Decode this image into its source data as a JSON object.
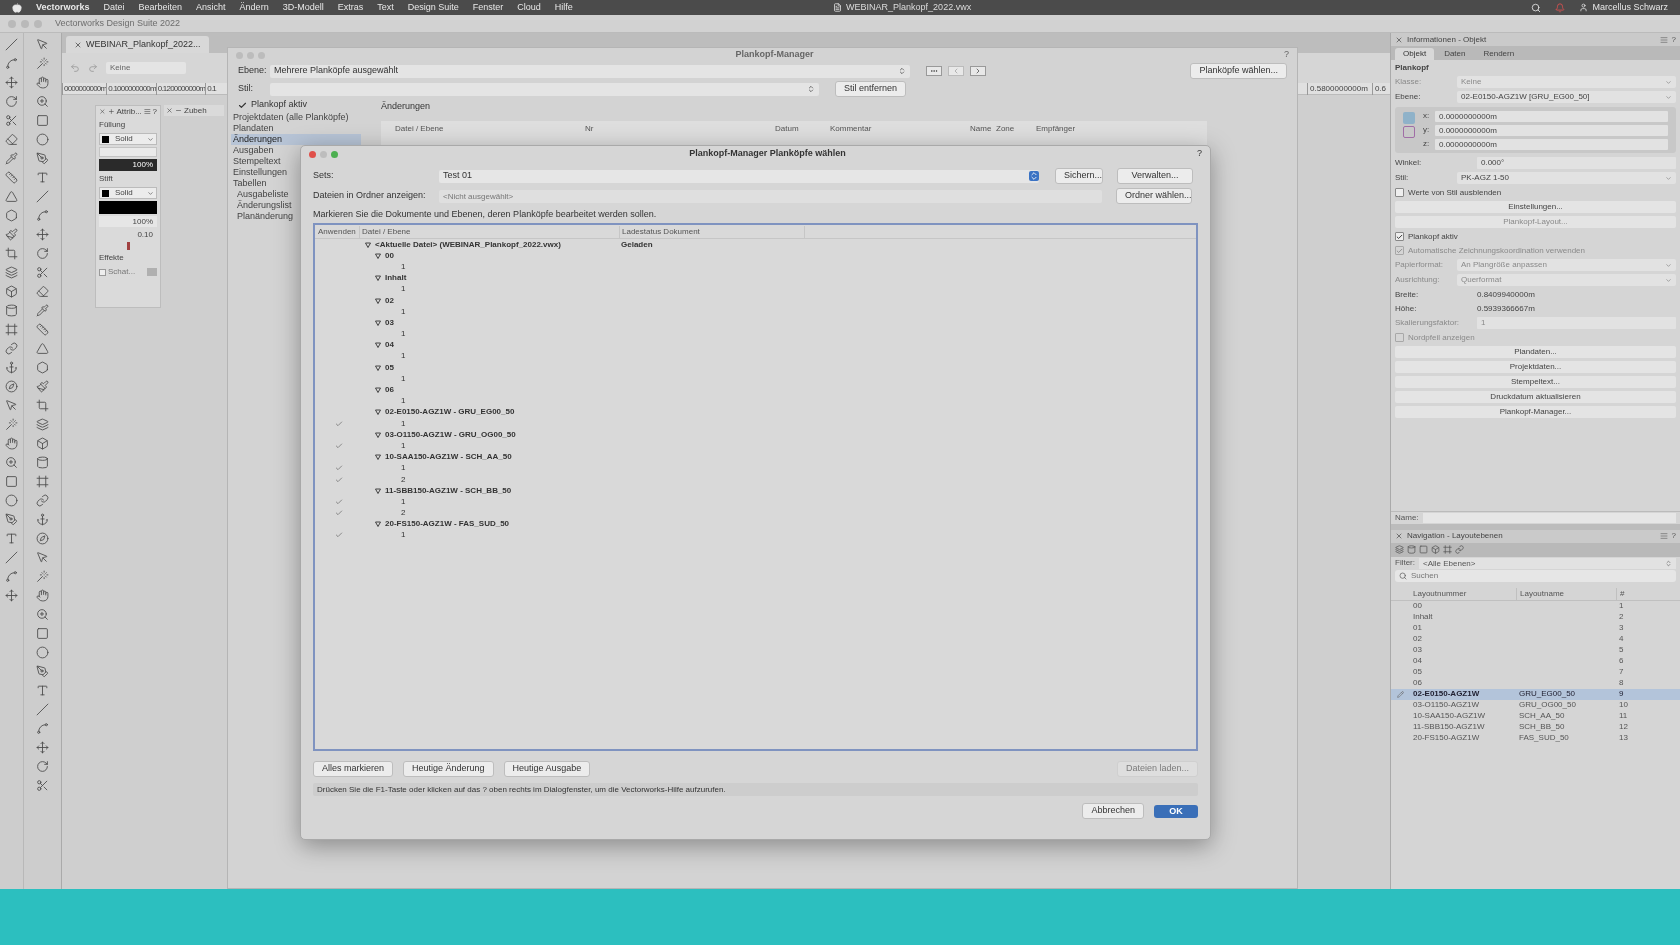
{
  "menu_bar": {
    "app": "Vectorworks",
    "items": [
      "Datei",
      "Bearbeiten",
      "Ansicht",
      "Ändern",
      "3D-Modell",
      "Extras",
      "Text",
      "Design Suite",
      "Fenster",
      "Cloud",
      "Hilfe"
    ],
    "document": "WEBINAR_Plankopf_2022.vwx",
    "user": "Marcellus Schwarz"
  },
  "app_window": {
    "title": "Vectorworks Design Suite 2022"
  },
  "document_tab": {
    "title": "WEBINAR_Plankopf_2022..."
  },
  "view_bar": {
    "class_field": "Keine"
  },
  "ruler": {
    "labels": [
      "0000000000m",
      "0.1000000000m",
      "0.1200000000m",
      "0.1"
    ],
    "right_labels": [
      "0.5800000000m",
      "0.6"
    ]
  },
  "attributes_palette": {
    "title": "Attrib...",
    "help": "?",
    "fill_label": "Füllung",
    "fill_style": "Solid",
    "fill_opacity": "100%",
    "pen_label": "Stift",
    "pen_style": "Solid",
    "pen_opacity": "100%",
    "line_weight": "0.10",
    "effects_label": "Effekte",
    "shadow": {
      "label": "Schat...",
      "checked": false
    }
  },
  "accessory_palette": {
    "title": "Zubeh"
  },
  "plankopf_manager": {
    "title": "Plankopf-Manager",
    "help": "?",
    "ebene_label": "Ebene:",
    "ebene_value": "Mehrere Planköpfe ausgewählt",
    "select_button": "Planköpfe wählen...",
    "stil_label": "Stil:",
    "remove_style_button": "Stil entfernen",
    "active": {
      "label": "Plankopf aktiv",
      "checked": true
    },
    "sections": [
      {
        "label": "Projektdaten (alle Planköpfe)",
        "selected": false
      },
      {
        "label": "Plandaten",
        "selected": false
      },
      {
        "label": "Änderungen",
        "selected": true
      },
      {
        "label": "Ausgaben",
        "selected": false
      },
      {
        "label": "Stempeltext",
        "selected": false
      },
      {
        "label": "Einstellungen",
        "selected": false
      },
      {
        "label": "Tabellen",
        "selected": false,
        "children": [
          {
            "label": "Ausgabeliste",
            "selected": false
          },
          {
            "label": "Änderungslist",
            "selected": false
          },
          {
            "label": "Planänderung",
            "selected": false
          }
        ]
      }
    ],
    "changes_title": "Änderungen",
    "changes_columns": [
      "Datei / Ebene",
      "Nr",
      "Datum",
      "Kommentar",
      "Name",
      "Zone",
      "Empfänger"
    ]
  },
  "dialog": {
    "title": "Plankopf-Manager Planköpfe wählen",
    "help": "?",
    "sets_label": "Sets:",
    "sets_value": "Test 01",
    "save_button": "Sichern...",
    "manage_button": "Verwalten...",
    "folder_label": "Dateien in Ordner anzeigen:",
    "folder_placeholder": "<Nicht ausgewählt>",
    "folder_button": "Ordner wählen...",
    "instruction": "Markieren Sie die Dokumente und Ebenen, deren Planköpfe bearbeitet werden sollen.",
    "columns": [
      "Anwenden",
      "Datei / Ebene",
      "Ladestatus Dokument"
    ],
    "tree": [
      {
        "label": "<Aktuelle Datei> (WEBINAR_Plankopf_2022.vwx)",
        "status": "Geladen",
        "expanded": true,
        "children": [
          {
            "label": "00",
            "expanded": true,
            "children": [
              {
                "label": "1",
                "applied": false
              }
            ]
          },
          {
            "label": "Inhalt",
            "expanded": true,
            "children": [
              {
                "label": "1",
                "applied": false
              }
            ]
          },
          {
            "label": "02",
            "expanded": true,
            "children": [
              {
                "label": "1",
                "applied": false
              }
            ]
          },
          {
            "label": "03",
            "expanded": true,
            "children": [
              {
                "label": "1",
                "applied": false
              }
            ]
          },
          {
            "label": "04",
            "expanded": true,
            "children": [
              {
                "label": "1",
                "applied": false
              }
            ]
          },
          {
            "label": "05",
            "expanded": true,
            "children": [
              {
                "label": "1",
                "applied": false
              }
            ]
          },
          {
            "label": "06",
            "expanded": true,
            "children": [
              {
                "label": "1",
                "applied": false
              }
            ]
          },
          {
            "label": "02-E0150-AGZ1W - GRU_EG00_50",
            "expanded": true,
            "children": [
              {
                "label": "1",
                "applied": true
              }
            ]
          },
          {
            "label": "03-O1150-AGZ1W - GRU_OG00_50",
            "expanded": true,
            "children": [
              {
                "label": "1",
                "applied": true
              }
            ]
          },
          {
            "label": "10-SAA150-AGZ1W - SCH_AA_50",
            "expanded": true,
            "children": [
              {
                "label": "1",
                "applied": true
              },
              {
                "label": "2",
                "applied": true
              }
            ]
          },
          {
            "label": "11-SBB150-AGZ1W - SCH_BB_50",
            "expanded": true,
            "children": [
              {
                "label": "1",
                "applied": true
              },
              {
                "label": "2",
                "applied": true
              }
            ]
          },
          {
            "label": "20-FS150-AGZ1W - FAS_SUD_50",
            "expanded": true,
            "children": [
              {
                "label": "1",
                "applied": true
              }
            ]
          }
        ]
      }
    ],
    "buttons": [
      "Alles markieren",
      "Heutige Änderung",
      "Heutige Ausgabe"
    ],
    "load_button": {
      "label": "Dateien laden...",
      "disabled": true
    },
    "help_text": "Drücken Sie die F1-Taste oder klicken auf das ? oben rechts im Dialogfenster, um die Vectorworks-Hilfe aufzurufen.",
    "cancel_button": "Abbrechen",
    "ok_button": "OK"
  },
  "info_panel": {
    "title": "Informationen - Objekt",
    "help": "?",
    "tabs": [
      {
        "label": "Objekt",
        "selected": true
      },
      {
        "label": "Daten",
        "selected": false
      },
      {
        "label": "Rendern",
        "selected": false
      }
    ],
    "heading": "Plankopf",
    "rows": [
      {
        "kind": "select",
        "label": "Klasse:",
        "value": "Keine",
        "disabled": true
      },
      {
        "kind": "select",
        "label": "Ebene:",
        "value": "02-E0150-AGZ1W [GRU_EG00_50]",
        "disabled": false
      },
      {
        "kind": "coords",
        "items": [
          {
            "label": "x:",
            "value": "0.0000000000m"
          },
          {
            "label": "y:",
            "value": "0.0000000000m"
          },
          {
            "label": "z:",
            "value": "0.0000000000m"
          }
        ]
      },
      {
        "kind": "field",
        "label": "Winkel:",
        "value": "0.000°",
        "disabled": false
      },
      {
        "kind": "select",
        "label": "Stil:",
        "value": "PK-AGZ 1-50",
        "disabled": false
      },
      {
        "kind": "checkbox",
        "label": "Werte von Stil ausblenden",
        "checked": false,
        "disabled": false
      },
      {
        "kind": "button",
        "label": "Einstellungen...",
        "disabled": false
      },
      {
        "kind": "button",
        "label": "Plankopf-Layout...",
        "disabled": true
      },
      {
        "kind": "checkbox",
        "label": "Plankopf aktiv",
        "checked": true,
        "disabled": false
      },
      {
        "kind": "checkbox",
        "label": "Automatische Zeichnungskoordination verwenden",
        "checked": true,
        "disabled": true
      },
      {
        "kind": "select",
        "label": "Papierformat:",
        "value": "An Plangröße anpassen",
        "disabled": true
      },
      {
        "kind": "select",
        "label": "Ausrichtung:",
        "value": "Querformat",
        "disabled": true
      },
      {
        "kind": "value",
        "label": "Breite:",
        "value": "0.8409940000m",
        "disabled": false
      },
      {
        "kind": "value",
        "label": "Höhe:",
        "value": "0.5939366667m",
        "disabled": false
      },
      {
        "kind": "field",
        "label": "Skalierungsfaktor:",
        "value": "1",
        "disabled": true
      },
      {
        "kind": "checkbox",
        "label": "Nordpfeil anzeigen",
        "checked": false,
        "disabled": true
      },
      {
        "kind": "button",
        "label": "Plandaten...",
        "disabled": false
      },
      {
        "kind": "button",
        "label": "Projektdaten...",
        "disabled": false
      },
      {
        "kind": "button",
        "label": "Stempeltext...",
        "disabled": false
      },
      {
        "kind": "button",
        "label": "Druckdatum aktualisieren",
        "disabled": false
      },
      {
        "kind": "button",
        "label": "Plankopf-Manager...",
        "disabled": false
      }
    ],
    "name_label": "Name:"
  },
  "nav_panel": {
    "title": "Navigation - Layoutebenen",
    "help": "?",
    "filter_label": "Filter:",
    "filter_value": "<Alle Ebenen>",
    "search_placeholder": "Suchen",
    "columns": [
      "Layoutnummer",
      "Layoutname",
      "#"
    ],
    "rows": [
      {
        "number": "00",
        "index": "1",
        "selected": false
      },
      {
        "number": "Inhalt",
        "index": "2",
        "selected": false
      },
      {
        "number": "01",
        "index": "3",
        "selected": false
      },
      {
        "number": "02",
        "index": "4",
        "selected": false
      },
      {
        "number": "03",
        "index": "5",
        "selected": false
      },
      {
        "number": "04",
        "index": "6",
        "selected": false
      },
      {
        "number": "05",
        "index": "7",
        "selected": false
      },
      {
        "number": "06",
        "index": "8",
        "selected": false
      },
      {
        "number": "02-E0150-AGZ1W",
        "name": "GRU_EG00_50",
        "index": "9",
        "selected": true
      },
      {
        "number": "03-O1150-AGZ1W",
        "name": "GRU_OG00_50",
        "index": "10",
        "selected": false
      },
      {
        "number": "10-SAA150-AGZ1W",
        "name": "SCH_AA_50",
        "index": "11",
        "selected": false
      },
      {
        "number": "11-SBB150-AGZ1W",
        "name": "SCH_BB_50",
        "index": "12",
        "selected": false
      },
      {
        "number": "20-FS150-AGZ1W",
        "name": "FAS_SUD_50",
        "index": "13",
        "selected": false
      }
    ]
  }
}
